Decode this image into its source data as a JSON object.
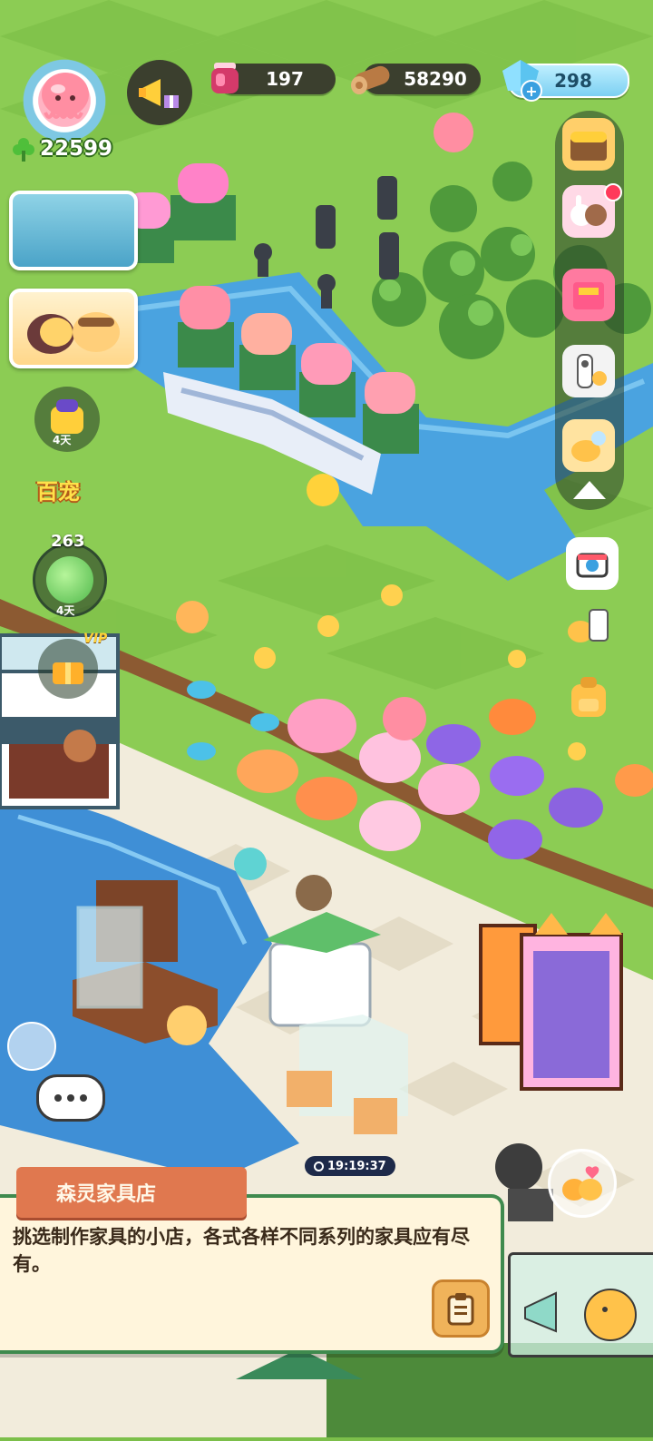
{
  "hud": {
    "clover_count": "22599",
    "potion_count": "197",
    "wood_count": "58290",
    "gem_count": "298",
    "gem_plus": "+"
  },
  "side": {
    "event_badge_days": "4天",
    "event_label": "百宠",
    "level_number": "263",
    "level_days": "4天",
    "vip_label": "VIP"
  },
  "shop_timer": "19:19:37",
  "info_card": {
    "title": "森灵家具店",
    "description": "挑选制作家具的小店，各式各样不同系列的家具应有尽有。"
  },
  "icons": {
    "avatar": "pink-jellyfish-avatar-icon",
    "megaphone": "megaphone-gift-icon",
    "potion": "red-potion-jar-icon",
    "wood": "wood-log-icon",
    "gem": "blue-crystal-icon",
    "chat": "chat-bubble-icon",
    "clipboard": "clipboard-icon",
    "camera": "camera-icon"
  },
  "colors": {
    "grass": "#7cbf4a",
    "river": "#4aa3e0",
    "card_bg": "#fff5dc",
    "card_border": "#3f8a4e",
    "title_tab": "#e0784f"
  }
}
